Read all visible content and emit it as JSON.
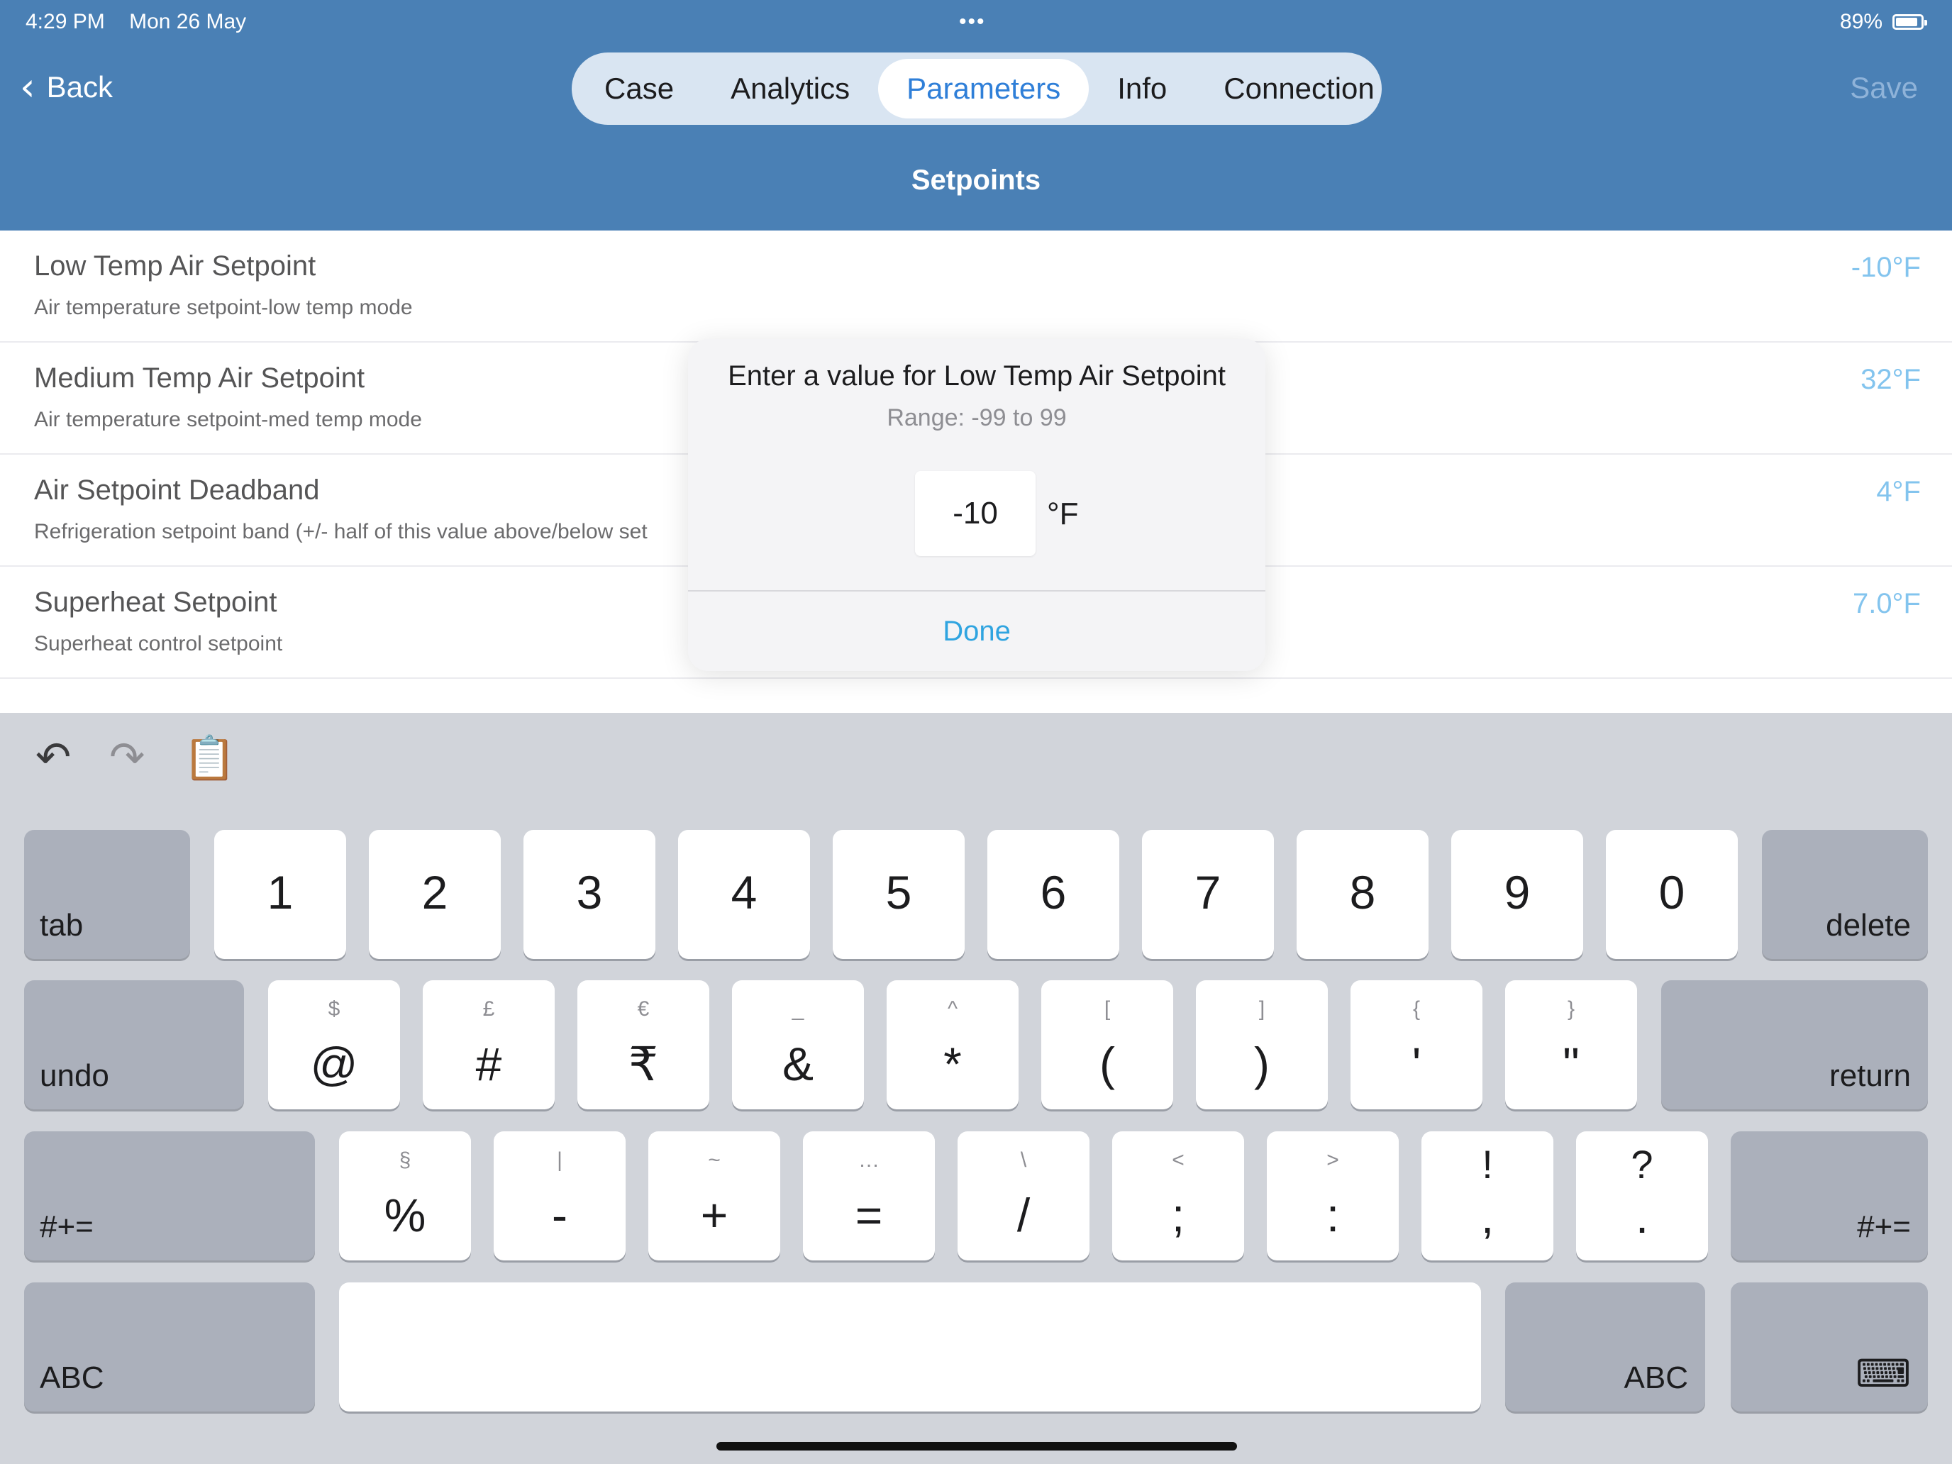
{
  "status": {
    "time": "4:29 PM",
    "date": "Mon 26 May",
    "dots": "•••",
    "battery": "89%"
  },
  "nav": {
    "back": "Back",
    "back_icon": "chevron-left-icon",
    "tabs": [
      {
        "label": "Case"
      },
      {
        "label": "Analytics"
      },
      {
        "label": "Parameters",
        "active": true
      },
      {
        "label": "Info"
      },
      {
        "label": "Connection"
      }
    ],
    "save": "Save",
    "subtitle": "Setpoints"
  },
  "rows": [
    {
      "title": "Low Temp Air Setpoint",
      "desc": "Air temperature setpoint-low temp mode",
      "value": "-10°F"
    },
    {
      "title": "Medium Temp Air Setpoint",
      "desc": "Air temperature setpoint-med temp mode",
      "value": "32°F"
    },
    {
      "title": "Air Setpoint Deadband",
      "desc": "Refrigeration setpoint band (+/- half of this value above/below set",
      "value": "4°F"
    },
    {
      "title": "Superheat Setpoint",
      "desc": "Superheat control setpoint",
      "value": "7.0°F"
    }
  ],
  "dialog": {
    "title": "Enter a value for Low Temp Air Setpoint",
    "range": "Range: -99 to 99",
    "input_value": "-10",
    "unit": "°F",
    "done": "Done"
  },
  "keyboard": {
    "toolbar": {
      "undo_icon": "undo-arrow-icon",
      "redo_icon": "redo-arrow-icon",
      "paste_icon": "clipboard-icon"
    },
    "row1": {
      "tab": "tab",
      "delete": "delete",
      "keys": [
        "1",
        "2",
        "3",
        "4",
        "5",
        "6",
        "7",
        "8",
        "9",
        "0"
      ]
    },
    "row2": {
      "undo": "undo",
      "return": "return",
      "keys": [
        {
          "main": "@",
          "sub": "$"
        },
        {
          "main": "#",
          "sub": "£"
        },
        {
          "main": "₹",
          "sub": "€"
        },
        {
          "main": "&",
          "sub": "_"
        },
        {
          "main": "*",
          "sub": "^"
        },
        {
          "main": "(",
          "sub": "["
        },
        {
          "main": ")",
          "sub": "]"
        },
        {
          "main": "'",
          "sub": "{"
        },
        {
          "main": "\"",
          "sub": "}"
        }
      ]
    },
    "row3": {
      "left": "#+=",
      "right": "#+=",
      "keys": [
        {
          "main": "%",
          "sub": "§"
        },
        {
          "main": "-",
          "sub": "|"
        },
        {
          "main": "+",
          "sub": "~"
        },
        {
          "main": "=",
          "sub": "…"
        },
        {
          "main": "/",
          "sub": "\\"
        },
        {
          "main": ";",
          "sub": "<"
        },
        {
          "main": ":",
          "sub": ">"
        },
        {
          "main": ",",
          "sub": "!"
        },
        {
          "main": ".",
          "sub": "?"
        }
      ]
    },
    "row4": {
      "abc_left": "ABC",
      "abc_right": "ABC",
      "dismiss_icon": "keyboard-dismiss-icon"
    }
  }
}
